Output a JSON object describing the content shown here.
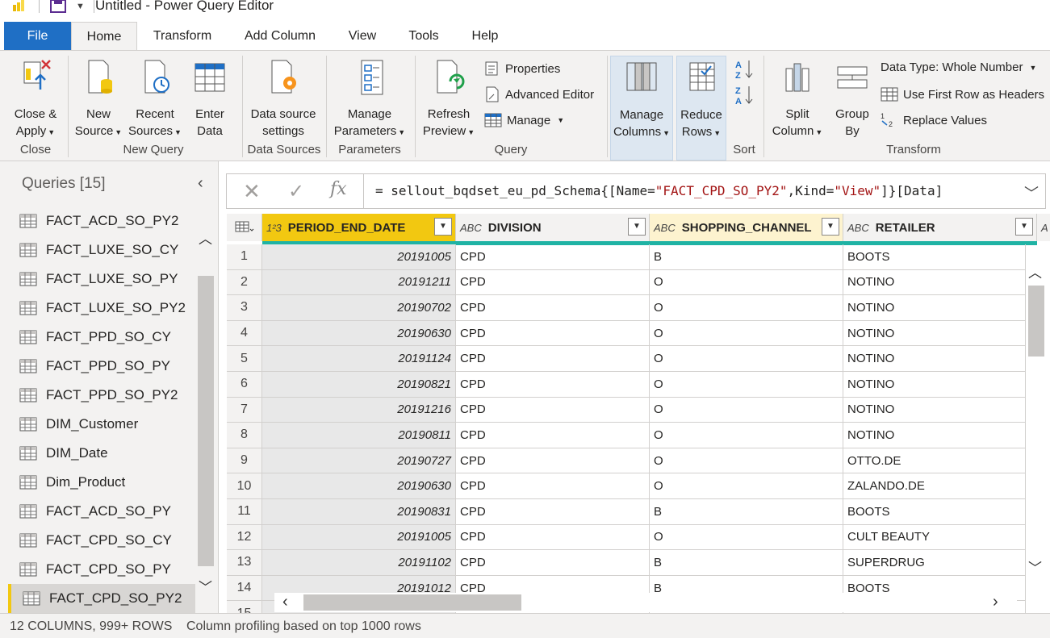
{
  "window": {
    "title": "Untitled - Power Query Editor"
  },
  "tabs": [
    "File",
    "Home",
    "Transform",
    "Add Column",
    "View",
    "Tools",
    "Help"
  ],
  "ribbon": {
    "close_apply": [
      "Close &",
      "Apply"
    ],
    "new_source": [
      "New",
      "Source"
    ],
    "recent_sources": [
      "Recent",
      "Sources"
    ],
    "enter_data": [
      "Enter",
      "Data"
    ],
    "data_source_settings": [
      "Data source",
      "settings"
    ],
    "manage_parameters": [
      "Manage",
      "Parameters"
    ],
    "refresh_preview": [
      "Refresh",
      "Preview"
    ],
    "properties": "Properties",
    "advanced_editor": "Advanced Editor",
    "manage": "Manage",
    "manage_columns": [
      "Manage",
      "Columns"
    ],
    "reduce_rows": [
      "Reduce",
      "Rows"
    ],
    "split_column": [
      "Split",
      "Column"
    ],
    "group_by": [
      "Group",
      "By"
    ],
    "data_type": "Data Type: Whole Number",
    "use_first_row": "Use First Row as Headers",
    "replace_values": "Replace Values",
    "groups": {
      "close": "Close",
      "new_query": "New Query",
      "data_sources": "Data Sources",
      "parameters": "Parameters",
      "query": "Query",
      "sort": "Sort",
      "transform": "Transform"
    }
  },
  "queries": {
    "header": "Queries [15]",
    "items": [
      "FACT_ACD_SO_PY2",
      "FACT_LUXE_SO_CY",
      "FACT_LUXE_SO_PY",
      "FACT_LUXE_SO_PY2",
      "FACT_PPD_SO_CY",
      "FACT_PPD_SO_PY",
      "FACT_PPD_SO_PY2",
      "DIM_Customer",
      "DIM_Date",
      "Dim_Product",
      "FACT_ACD_SO_PY",
      "FACT_CPD_SO_CY",
      "FACT_CPD_SO_PY",
      "FACT_CPD_SO_PY2"
    ],
    "active": "FACT_CPD_SO_PY2"
  },
  "formula": {
    "prefix": "= sellout_bqdset_eu_pd_Schema{[Name=",
    "name_value": "\"FACT_CPD_SO_PY2\"",
    "mid": ",Kind=",
    "kind_value": "\"View\"",
    "suffix": "]}[Data]"
  },
  "grid": {
    "columns": [
      {
        "name": "PERIOD_END_DATE",
        "type_icon": "1²3"
      },
      {
        "name": "DIVISION",
        "type_icon": "ABC"
      },
      {
        "name": "SHOPPING_CHANNEL",
        "type_icon": "ABC"
      },
      {
        "name": "RETAILER",
        "type_icon": "ABC"
      }
    ],
    "next_column_partial": "A",
    "rows": [
      [
        "1",
        "20191005",
        "CPD",
        "B",
        "BOOTS"
      ],
      [
        "2",
        "20191211",
        "CPD",
        "O",
        "NOTINO"
      ],
      [
        "3",
        "20190702",
        "CPD",
        "O",
        "NOTINO"
      ],
      [
        "4",
        "20190630",
        "CPD",
        "O",
        "NOTINO"
      ],
      [
        "5",
        "20191124",
        "CPD",
        "O",
        "NOTINO"
      ],
      [
        "6",
        "20190821",
        "CPD",
        "O",
        "NOTINO"
      ],
      [
        "7",
        "20191216",
        "CPD",
        "O",
        "NOTINO"
      ],
      [
        "8",
        "20190811",
        "CPD",
        "O",
        "NOTINO"
      ],
      [
        "9",
        "20190727",
        "CPD",
        "O",
        "OTTO.DE"
      ],
      [
        "10",
        "20190630",
        "CPD",
        "O",
        "ZALANDO.DE"
      ],
      [
        "11",
        "20190831",
        "CPD",
        "B",
        "BOOTS"
      ],
      [
        "12",
        "20191005",
        "CPD",
        "O",
        "CULT BEAUTY"
      ],
      [
        "13",
        "20191102",
        "CPD",
        "B",
        "SUPERDRUG"
      ],
      [
        "14",
        "20191012",
        "CPD",
        "B",
        "BOOTS"
      ],
      [
        "15",
        "",
        "",
        "",
        ""
      ]
    ]
  },
  "status": {
    "counts": "12 COLUMNS, 999+ ROWS",
    "profiling": "Column profiling based on top 1000 rows"
  }
}
